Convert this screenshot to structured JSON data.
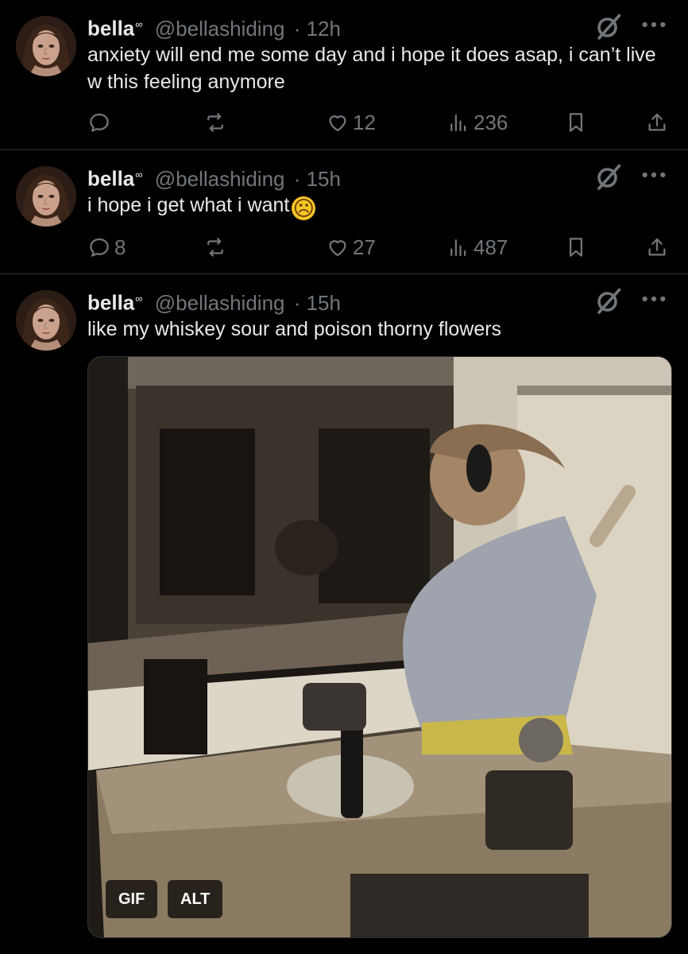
{
  "tweets": [
    {
      "name": "bella",
      "name_mark": "∞",
      "handle": "@bellashiding",
      "time": "· 12h",
      "text": "anxiety will end me some day and i hope it does asap, i can’t live w this feeling anymore",
      "replies": "",
      "reposts": "",
      "likes": "12",
      "views": "236"
    },
    {
      "name": "bella",
      "name_mark": "∞",
      "handle": "@bellashiding",
      "time": "· 15h",
      "text": "i hope i get what i want",
      "emoji": "☹",
      "replies": "8",
      "reposts": "",
      "likes": "27",
      "views": "487"
    },
    {
      "name": "bella",
      "name_mark": "∞",
      "handle": "@bellashiding",
      "time": "· 15h",
      "text": "like my whiskey sour and poison thorny flowers",
      "media": {
        "gif_label": "GIF",
        "alt_label": "ALT"
      }
    }
  ],
  "colors": {
    "background": "#000000",
    "text": "#e7e9ea",
    "muted": "#71767b",
    "divider": "#2f3336"
  },
  "icons": [
    "avatar",
    "grok-icon",
    "more-icon",
    "reply-icon",
    "repost-icon",
    "like-icon",
    "views-icon",
    "bookmark-icon",
    "share-icon"
  ]
}
